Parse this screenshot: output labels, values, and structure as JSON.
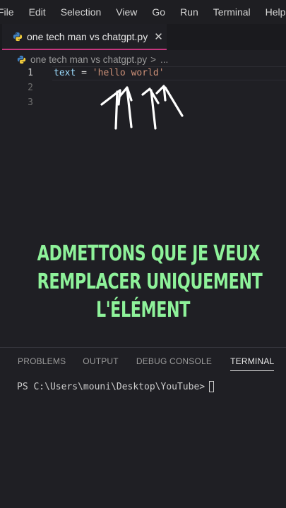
{
  "menu": [
    "File",
    "Edit",
    "Selection",
    "View",
    "Go",
    "Run",
    "Terminal",
    "Help"
  ],
  "tab": {
    "filename": "one tech man vs chatgpt.py",
    "close_glyph": "✕",
    "icon": "python-file-icon"
  },
  "breadcrumb": {
    "filename": "one tech man vs chatgpt.py",
    "separator": ">",
    "ellipsis": "..."
  },
  "editor": {
    "line_numbers": [
      "1",
      "2",
      "3"
    ],
    "code": {
      "variable": "text",
      "operator": " = ",
      "string": "'hello world'"
    }
  },
  "caption": {
    "lines": [
      "ADMETTONS QUE JE VEUX",
      "REMPLACER UNIQUEMENT",
      "L'ÉLÉMENT"
    ],
    "color": "#8ef29a"
  },
  "panel": {
    "tabs": [
      "PROBLEMS",
      "OUTPUT",
      "DEBUG CONSOLE",
      "TERMINAL"
    ],
    "active_tab": "TERMINAL",
    "prompt": "PS C:\\Users\\mouni\\Desktop\\YouTube>"
  },
  "colors": {
    "accent_tab_border": "#c5367e",
    "string": "#ce9178",
    "variable": "#9cdcfe"
  }
}
